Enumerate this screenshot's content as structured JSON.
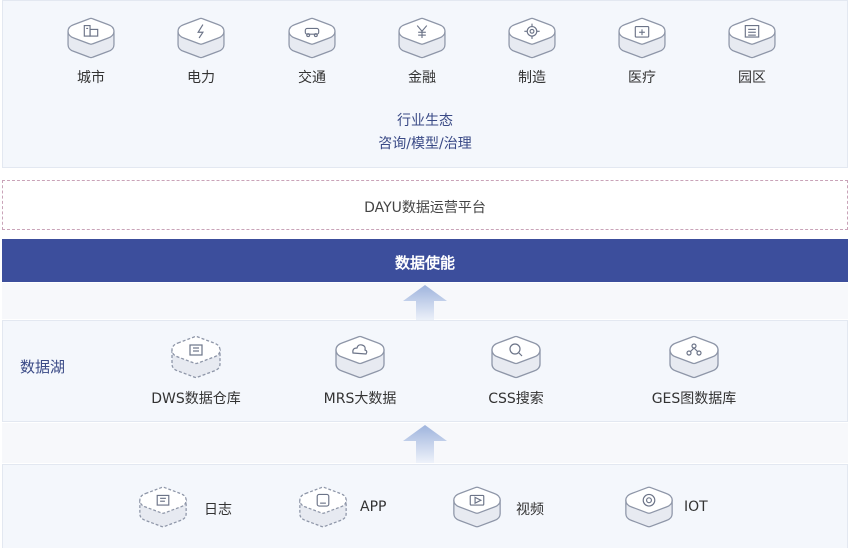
{
  "industries": [
    {
      "label": "城市",
      "icon": "building-icon"
    },
    {
      "label": "电力",
      "icon": "lightning-icon"
    },
    {
      "label": "交通",
      "icon": "car-icon"
    },
    {
      "label": "金融",
      "icon": "yuan-icon"
    },
    {
      "label": "制造",
      "icon": "gear-icon"
    },
    {
      "label": "医疗",
      "icon": "medical-box-icon"
    },
    {
      "label": "园区",
      "icon": "office-building-icon"
    }
  ],
  "ecosystem": {
    "line1": "行业生态",
    "line2": "咨询/模型/治理"
  },
  "platform": {
    "label": "DAYU数据运营平台"
  },
  "enablement": {
    "label": "数据使能"
  },
  "data_lake": {
    "title": "数据湖",
    "items": [
      {
        "label": "DWS数据仓库",
        "icon": "data-warehouse-icon"
      },
      {
        "label": "MRS大数据",
        "icon": "cloud-icon"
      },
      {
        "label": "CSS搜索",
        "icon": "search-icon"
      },
      {
        "label": "GES图数据库",
        "icon": "graph-icon"
      }
    ]
  },
  "sources": [
    {
      "label": "日志",
      "icon": "log-icon"
    },
    {
      "label": "APP",
      "icon": "app-icon"
    },
    {
      "label": "视频",
      "icon": "video-icon"
    },
    {
      "label": "IOT",
      "icon": "iot-icon"
    }
  ],
  "colors": {
    "accent": "#3c4e9c",
    "panel": "#f4f7fc",
    "text_blue": "#3a4a86"
  }
}
